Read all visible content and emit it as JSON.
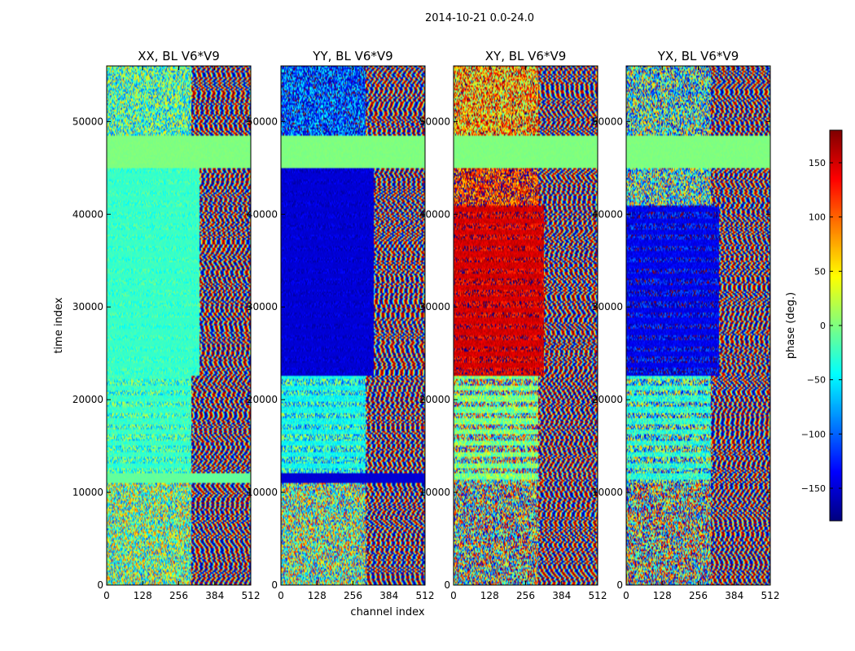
{
  "figure": {
    "suptitle": "2014-10-21 0.0-24.0",
    "xlabel": "channel index",
    "ylabel": "time index"
  },
  "chart_data": {
    "type": "heatmap",
    "colormap": "jet",
    "grid": false,
    "legend": "colorbar-right",
    "xlim": [
      0,
      512
    ],
    "ylim": [
      0,
      56000
    ],
    "x_ticks": [
      0,
      128,
      256,
      384,
      512
    ],
    "y_ticks": [
      0,
      10000,
      20000,
      30000,
      40000,
      50000
    ],
    "panels": [
      {
        "title": "XX, BL V6*V9",
        "bands": [
          {
            "t0": 0,
            "t1": 11000,
            "kind": "noise",
            "center": 0,
            "spread": 110
          },
          {
            "t0": 11000,
            "t1": 12000,
            "kind": "solid",
            "center": -10
          },
          {
            "t0": 12000,
            "t1": 22500,
            "kind": "striped",
            "center": -25,
            "spread": 60
          },
          {
            "t0": 22500,
            "t1": 45000,
            "kind": "striped",
            "center": -25,
            "spread": 25,
            "cutoff": 330
          },
          {
            "t0": 45000,
            "t1": 48500,
            "kind": "solid",
            "center": 0
          },
          {
            "t0": 48500,
            "t1": 56000,
            "kind": "noise",
            "center": -20,
            "spread": 90
          }
        ]
      },
      {
        "title": "YY, BL V6*V9",
        "bands": [
          {
            "t0": 0,
            "t1": 11000,
            "kind": "noise",
            "center": 0,
            "spread": 130
          },
          {
            "t0": 11000,
            "t1": 12000,
            "kind": "solid",
            "center": -150
          },
          {
            "t0": 12000,
            "t1": 22500,
            "kind": "striped",
            "center": -40,
            "spread": 80
          },
          {
            "t0": 22500,
            "t1": 45000,
            "kind": "striped",
            "center": -150,
            "spread": 20,
            "cutoff": 330
          },
          {
            "t0": 45000,
            "t1": 48500,
            "kind": "solid",
            "center": 0
          },
          {
            "t0": 48500,
            "t1": 56000,
            "kind": "noise",
            "center": -110,
            "spread": 80
          }
        ]
      },
      {
        "title": "XY, BL V6*V9",
        "bands": [
          {
            "t0": 0,
            "t1": 11000,
            "kind": "noise",
            "center": 0,
            "spread": 170
          },
          {
            "t0": 11000,
            "t1": 22500,
            "kind": "striped",
            "center": 0,
            "spread": 150
          },
          {
            "t0": 22500,
            "t1": 41000,
            "kind": "striped",
            "center": 150,
            "spread": 45,
            "cutoff": 320
          },
          {
            "t0": 41000,
            "t1": 45000,
            "kind": "noise",
            "center": 130,
            "spread": 90
          },
          {
            "t0": 45000,
            "t1": 48500,
            "kind": "solid",
            "center": 0
          },
          {
            "t0": 48500,
            "t1": 56000,
            "kind": "noise",
            "center": 80,
            "spread": 110
          }
        ]
      },
      {
        "title": "YX, BL V6*V9",
        "bands": [
          {
            "t0": 0,
            "t1": 11000,
            "kind": "noise",
            "center": 0,
            "spread": 170
          },
          {
            "t0": 11000,
            "t1": 22500,
            "kind": "striped",
            "center": -30,
            "spread": 130
          },
          {
            "t0": 22500,
            "t1": 41000,
            "kind": "striped",
            "center": -140,
            "spread": 50,
            "cutoff": 330
          },
          {
            "t0": 41000,
            "t1": 45000,
            "kind": "noise",
            "center": -20,
            "spread": 140
          },
          {
            "t0": 45000,
            "t1": 48500,
            "kind": "solid",
            "center": 0
          },
          {
            "t0": 48500,
            "t1": 56000,
            "kind": "noise",
            "center": -30,
            "spread": 140
          }
        ]
      }
    ],
    "colorbar": {
      "label": "phase (deg.)",
      "range": [
        -180,
        180
      ],
      "ticks": [
        -150,
        -100,
        -50,
        0,
        50,
        100,
        150
      ],
      "tick_labels": [
        "−150",
        "−100",
        "−50",
        "0",
        "50",
        "100",
        "150"
      ]
    }
  }
}
